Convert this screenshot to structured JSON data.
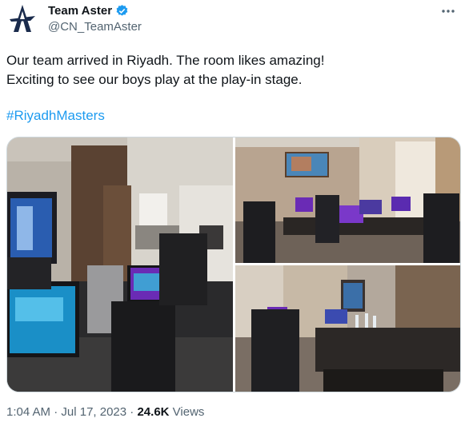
{
  "account": {
    "name": "Team Aster",
    "handle": "@CN_TeamAster",
    "verified_icon": "verified-badge-icon",
    "avatar_icon": "team-aster-logo"
  },
  "tweet": {
    "line1": "Our team arrived in Riyadh. The room likes amazing!",
    "line2": "Exciting to see our boys play at the play-in stage.",
    "hashtag": "#RiyadhMasters"
  },
  "media": {
    "count": 3,
    "images": [
      {
        "name": "gaming-room-photo-left"
      },
      {
        "name": "gaming-room-photo-top-right"
      },
      {
        "name": "gaming-room-photo-bottom-right"
      }
    ]
  },
  "meta": {
    "time": "1:04 AM",
    "separator1": "·",
    "date": "Jul 17, 2023",
    "separator2": "·",
    "views_count": "24.6K",
    "views_label": "Views"
  },
  "colors": {
    "link": "#1d9bf0",
    "text": "#0f1419",
    "muted": "#536471",
    "border": "#cfd9de"
  }
}
